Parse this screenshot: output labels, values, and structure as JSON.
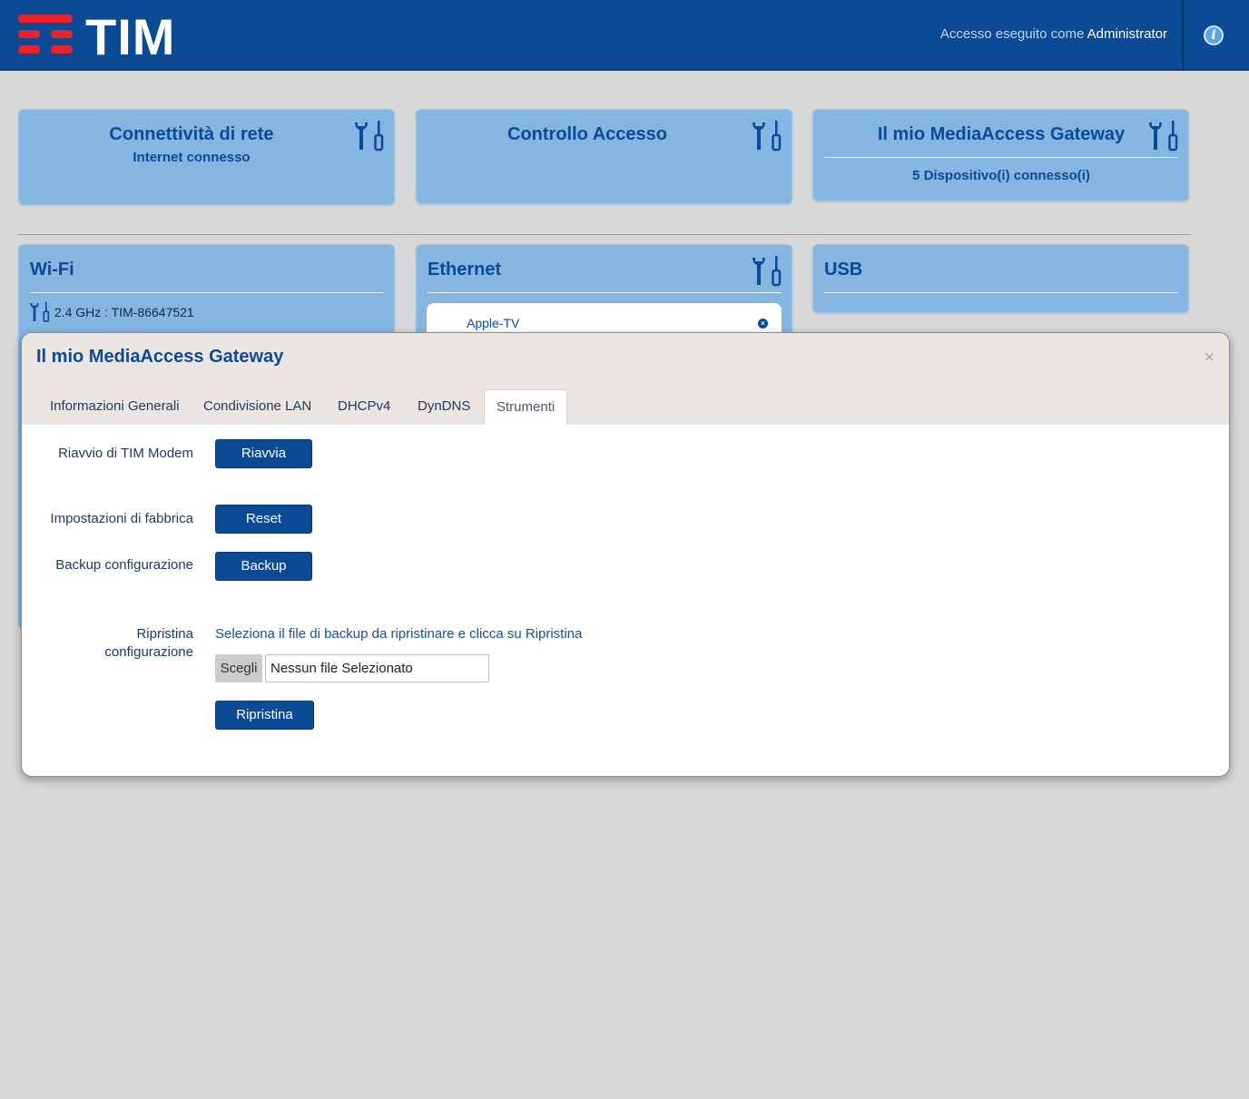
{
  "header": {
    "brand": "TIM",
    "login_prefix": "Accesso eseguito come",
    "login_user": "Administrator",
    "info_icon": "info-icon"
  },
  "cards": {
    "network": {
      "title": "Connettività di rete",
      "status": "Internet connesso"
    },
    "access": {
      "title": "Controllo Accesso"
    },
    "gateway": {
      "title": "Il mio MediaAccess Gateway",
      "status": "5 Dispositivo(i) connesso(i)"
    },
    "wifi": {
      "title": "Wi-Fi",
      "network_line": "2.4 GHz : TIM-86647521"
    },
    "ethernet": {
      "title": "Ethernet",
      "device": "Apple-TV"
    },
    "usb": {
      "title": "USB"
    }
  },
  "modal": {
    "title": "Il mio MediaAccess Gateway",
    "close": "×",
    "tabs": [
      {
        "label": "Informazioni Generali",
        "active": false
      },
      {
        "label": "Condivisione LAN",
        "active": false
      },
      {
        "label": "DHCPv4",
        "active": false
      },
      {
        "label": "DynDNS",
        "active": false
      },
      {
        "label": "Strumenti",
        "active": true
      }
    ],
    "reboot": {
      "label": "Riavvio di TIM Modem",
      "button": "Riavvia"
    },
    "factory": {
      "label": "Impostazioni di fabbrica",
      "button": "Reset"
    },
    "backup": {
      "label": "Backup configurazione",
      "button": "Backup"
    },
    "restore": {
      "label_line1": "Ripristina",
      "label_line2": "configurazione",
      "hint": "Seleziona il file di backup da ripristinare e clicca su Ripristina",
      "choose_button": "Scegli",
      "file_value": "Nessun file Selezionato",
      "button": "Ripristina"
    }
  },
  "colors": {
    "header_bg": "#0b4a94",
    "brand_red": "#e8232f",
    "card_bg": "#85b6e2",
    "accent": "#0b4a94"
  }
}
